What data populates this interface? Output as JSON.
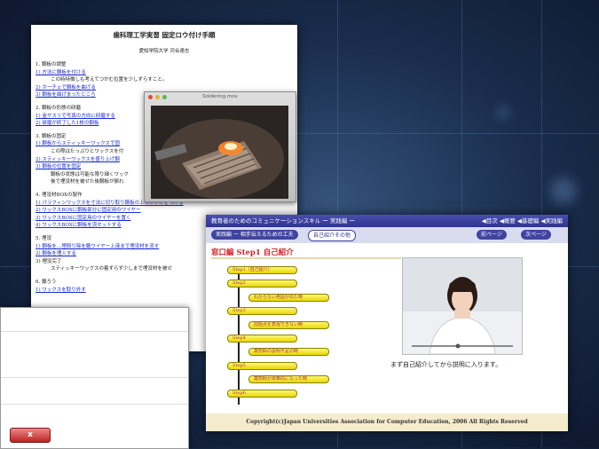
{
  "document": {
    "title": "歯科理工学実習 固定ロウ付け手順",
    "author": "愛知学院大学 河合達志",
    "lines": [
      "1. 鋼板の調整",
      "1) 方法に鋼板を付ける",
      "この時特徴しも考えてつかむ位置を少しずらすこと。",
      "2) ホーチェで鋼板を曲げる",
      "3) 鋼板を曲げまったところ",
      "2. 鋼板の形態の研磨",
      "1) 金ヤスリで写真の方向に研磨する",
      "2) 研磨が終了した1枚の鋼板",
      "3. 鋼板の固定",
      "1) 鋼板からスティッキーワックスで固",
      "この際はたっぷりとワックスを付",
      "2) スティッキーワックスを盛り上げ鋼",
      "3) 鋼板の位置を固定",
      "鋼板の状態は可能な限り細くワック",
      "後で埋没材を被せた後鋼板が振れ",
      "4. 埋没材BOXの製作",
      "1) パラフィンワックスを寸法に切り取り鋼板の上のかがけをつける",
      "2) ワックスBOXに鋼板部分に固定用のワイヤー",
      "3) ワックスBOXに固定用のワイヤーを置く",
      "4) ワックスBOXに鋼板を流セットする",
      "5. 埋没",
      "1) 鋼板を…埋殻り除を鍛ワイヤー上液まで埋没材を流す",
      "2) 鋼板を埋入する",
      "3) 埋没完了",
      "スティッキーワックスの着ずらず少しまで埋没材を被せ",
      "6. 鑞ろう",
      "1) ワックスを取り外す"
    ]
  },
  "movie_window": {
    "title": "Soldering.mov"
  },
  "edu_window": {
    "top_title": "教育者のためのコミュニケーションスキル ー 実践編 ー",
    "top_nav": "◀目次 ◀概要 ◀基礎編 ◀実践編",
    "breadcrumb_1": "実践編 ー 相手伝えるための工夫",
    "breadcrumb_2": "自己紹介その他",
    "prev_page": "前ページ",
    "next_page": "次ページ",
    "heading": "窓口編 Step1 自己紹介",
    "steps": [
      "Step1（自己紹介）",
      "Step2",
      "わからない用語が出た時",
      "Step3",
      "問題点を表現できない時",
      "Step4",
      "薬剤師の説明不足の時",
      "Step5",
      "薬剤師が目撃的になった時",
      "Step6"
    ],
    "caption": "まず自己紹介してから説明に入ります。",
    "footer": "Copyright(c)Japan Universities Association for Computer Education, 2006 All Rights Reserved"
  },
  "dialog": {
    "close_label": "x"
  },
  "colors": {
    "accent_red": "#d2232a",
    "nav_blue": "#2f348c"
  }
}
